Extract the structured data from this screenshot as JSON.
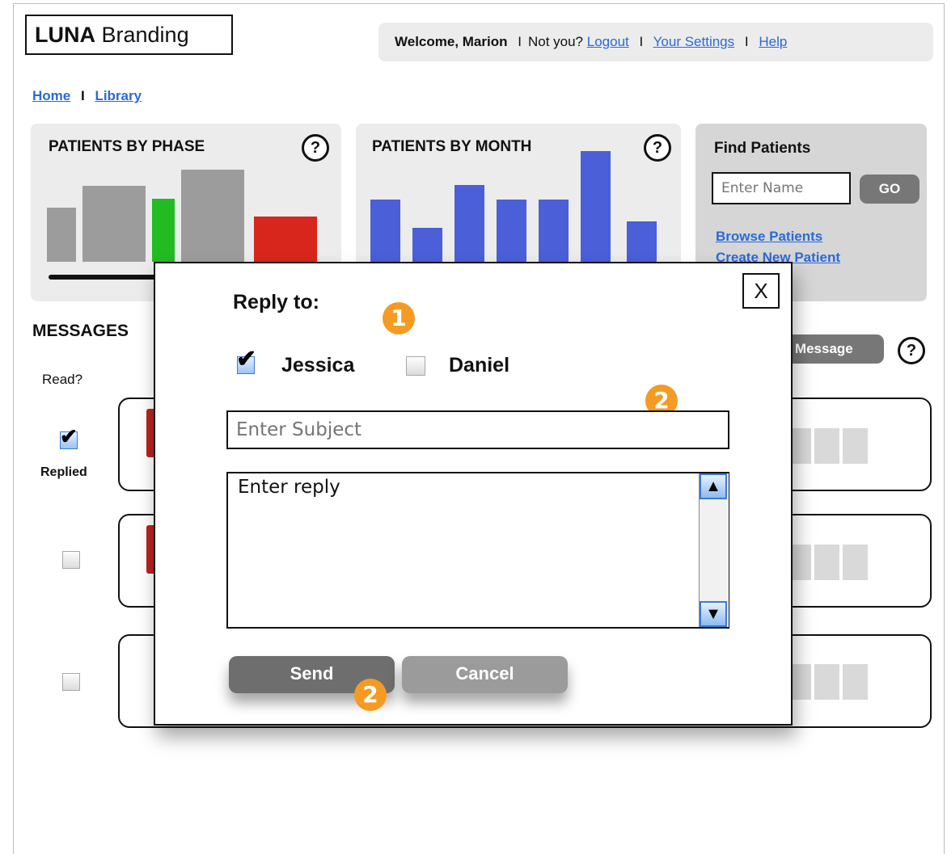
{
  "brand": {
    "bold": "LUNA",
    "rest": " Branding"
  },
  "userbar": {
    "welcome": "Welcome, Marion",
    "notyou": "Not  you?",
    "logout": "Logout",
    "settings": "Your Settings",
    "help": "Help",
    "sep": "I"
  },
  "breadcrumb": {
    "home": "Home",
    "sep": "I",
    "library": "Library"
  },
  "phase_panel": {
    "title": "PATIENTS BY PHASE",
    "help": "?"
  },
  "month_panel": {
    "title": "PATIENTS BY MONTH",
    "help": "?"
  },
  "find": {
    "title": "Find Patients",
    "placeholder": "Enter Name",
    "go": "GO",
    "browse": "Browse Patients",
    "create": "Create New Patient"
  },
  "messages": {
    "title": "MESSAGES",
    "read_header": "Read?",
    "replied": "Replied",
    "new_button": "New Message",
    "help": "?"
  },
  "chart_data": [
    {
      "type": "bar",
      "title": "PATIENTS BY PHASE",
      "values": [
        56,
        78,
        65,
        95,
        47
      ],
      "colors": [
        "#9c9c9c",
        "#9c9c9c",
        "#22bb22",
        "#9c9c9c",
        "#d9261c"
      ]
    },
    {
      "type": "bar",
      "title": "PATIENTS BY MONTH",
      "values": [
        64,
        35,
        79,
        64,
        64,
        114,
        42
      ],
      "colors": [
        "#4a5fd8",
        "#4a5fd8",
        "#4a5fd8",
        "#4a5fd8",
        "#4a5fd8",
        "#4a5fd8",
        "#4a5fd8"
      ]
    }
  ],
  "modal": {
    "close": "X",
    "reply_to": "Reply to:",
    "recipients": [
      {
        "name": "Jessica",
        "checked": true
      },
      {
        "name": "Daniel",
        "checked": false
      }
    ],
    "subject_placeholder": "Enter Subject",
    "reply_placeholder": "Enter reply",
    "send": "Send",
    "cancel": "Cancel",
    "badges": [
      "1",
      "2",
      "2"
    ]
  },
  "colors": {
    "link": "#2a6ad8",
    "badge": "#f59a22",
    "panel": "#ececec",
    "button": "#777777"
  }
}
